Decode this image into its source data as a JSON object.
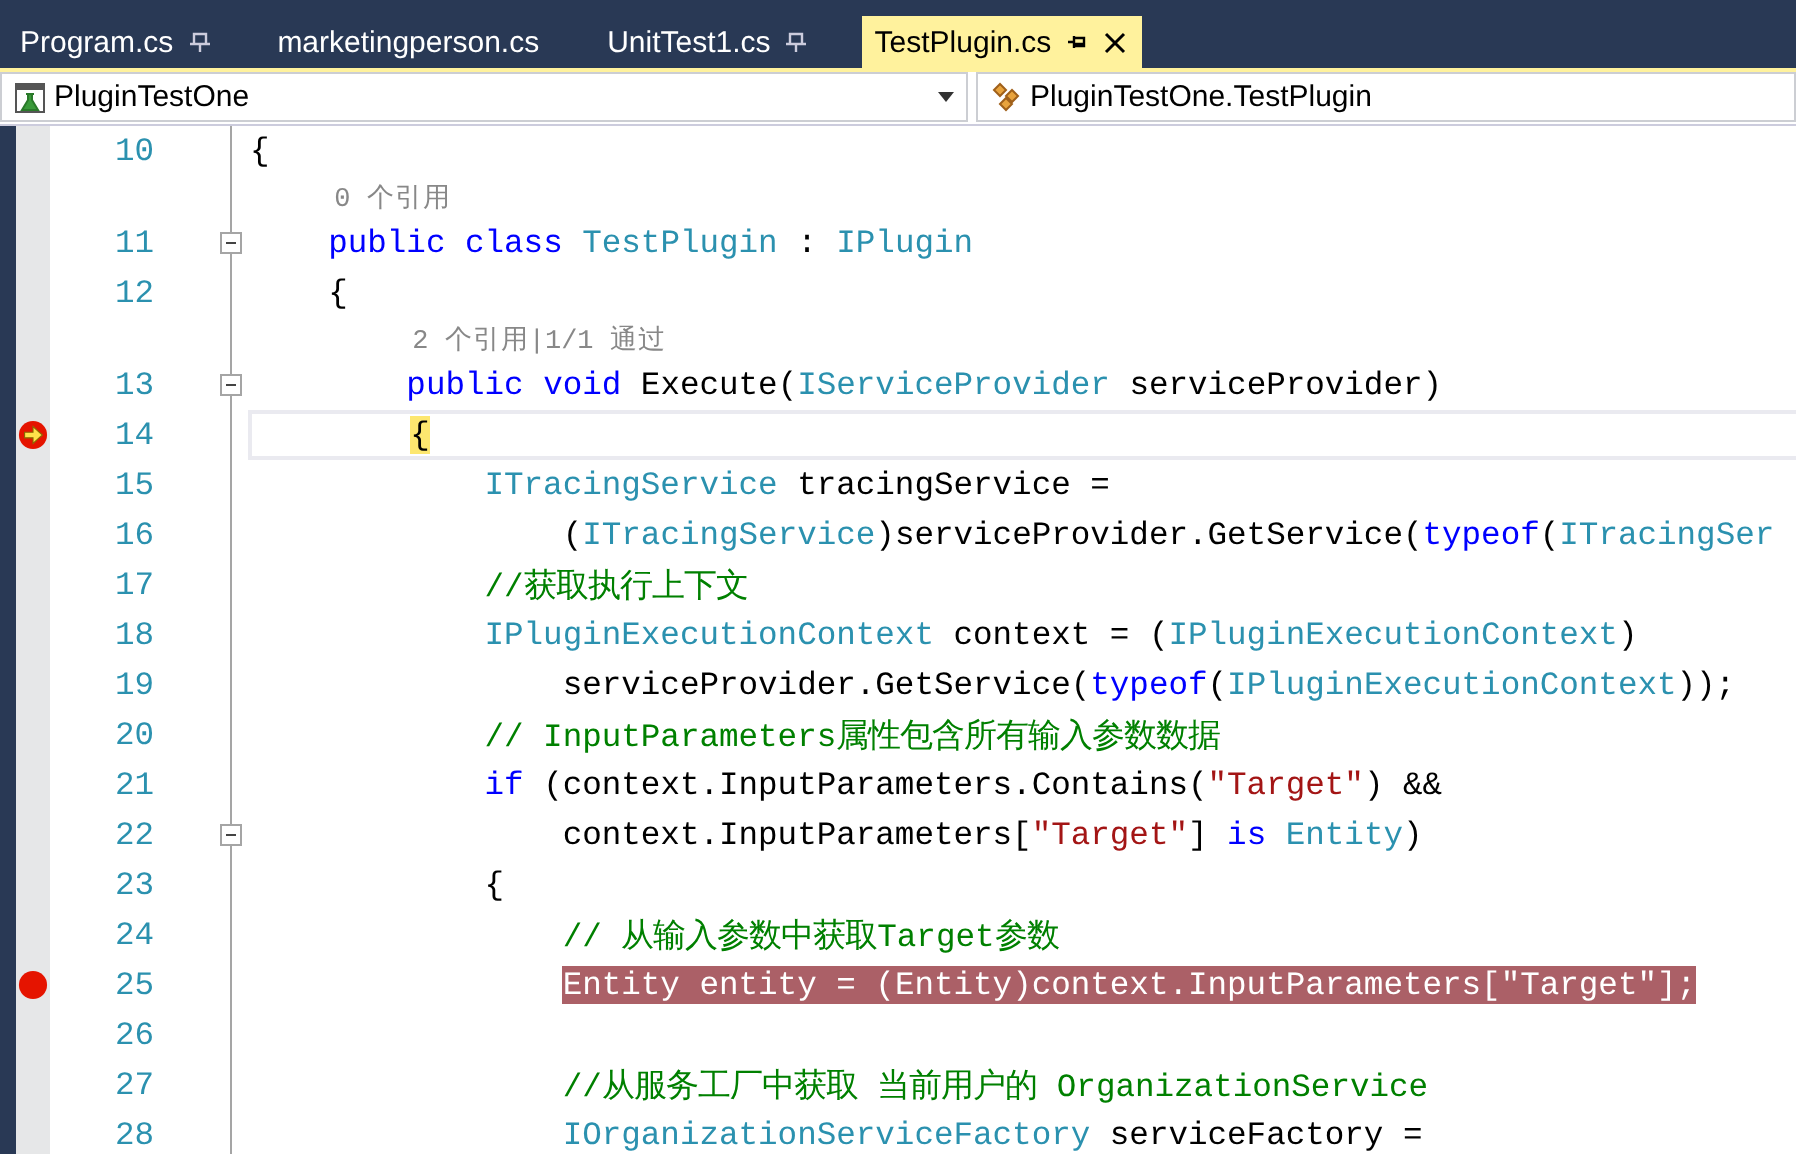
{
  "tabs": [
    {
      "label": "Program.cs",
      "selected": false,
      "pinned": true
    },
    {
      "label": "marketingperson.cs",
      "selected": false,
      "pinned": false
    },
    {
      "label": "UnitTest1.cs",
      "selected": false,
      "pinned": true
    },
    {
      "label": "TestPlugin.cs",
      "selected": true,
      "pinned": true
    }
  ],
  "navigation": {
    "project": "PluginTestOne",
    "member": "PluginTestOne.TestPlugin"
  },
  "editor": {
    "lines": [
      {
        "number": "10",
        "collapsible": false,
        "breakpoint": false,
        "current_statement": false,
        "tokens": [
          {
            "kind": "plain",
            "text": "{"
          }
        ]
      },
      {
        "number": "11",
        "hint": "0 个引用",
        "collapsible": true,
        "breakpoint": false,
        "current_statement": false,
        "tokens": [
          {
            "kind": "keyword",
            "text": "    public"
          },
          {
            "kind": "keyword",
            "text": " class"
          },
          {
            "kind": "type",
            "text": " TestPlugin"
          },
          {
            "kind": "plain",
            "text": " : "
          },
          {
            "kind": "type",
            "text": "IPlugin"
          }
        ]
      },
      {
        "number": "12",
        "collapsible": false,
        "breakpoint": false,
        "current_statement": false,
        "tokens": [
          {
            "kind": "plain",
            "text": "    {"
          }
        ]
      },
      {
        "number": "13",
        "hint": "2 个引用|1/1 通过",
        "collapsible": true,
        "breakpoint": false,
        "current_statement": false,
        "tokens": [
          {
            "kind": "keyword",
            "text": "        public"
          },
          {
            "kind": "keyword",
            "text": " void"
          },
          {
            "kind": "plain",
            "text": " Execute("
          },
          {
            "kind": "type",
            "text": "IServiceProvider"
          },
          {
            "kind": "plain",
            "text": " serviceProvider)"
          }
        ]
      },
      {
        "number": "14",
        "collapsible": false,
        "breakpoint": true,
        "current_statement": true,
        "tokens": [
          {
            "kind": "plain",
            "text": "        {"
          }
        ]
      },
      {
        "number": "15",
        "collapsible": false,
        "breakpoint": false,
        "current_statement": false,
        "tokens": [
          {
            "kind": "type",
            "text": "            ITracingService"
          },
          {
            "kind": "plain",
            "text": " tracingService ="
          }
        ]
      },
      {
        "number": "16",
        "collapsible": false,
        "breakpoint": false,
        "current_statement": false,
        "tokens": [
          {
            "kind": "plain",
            "text": "                ("
          },
          {
            "kind": "type",
            "text": "ITracingService"
          },
          {
            "kind": "plain",
            "text": ")serviceProvider.GetService("
          },
          {
            "kind": "keyword",
            "text": "typeof"
          },
          {
            "kind": "plain",
            "text": "("
          },
          {
            "kind": "type",
            "text": "ITracingSer"
          }
        ]
      },
      {
        "number": "17",
        "collapsible": false,
        "breakpoint": false,
        "current_statement": false,
        "tokens": [
          {
            "kind": "comment",
            "text": "            //获取执行上下文"
          }
        ]
      },
      {
        "number": "18",
        "collapsible": false,
        "breakpoint": false,
        "current_statement": false,
        "tokens": [
          {
            "kind": "type",
            "text": "            IPluginExecutionContext"
          },
          {
            "kind": "plain",
            "text": " context = ("
          },
          {
            "kind": "type",
            "text": "IPluginExecutionContext"
          },
          {
            "kind": "plain",
            "text": ")"
          }
        ]
      },
      {
        "number": "19",
        "collapsible": false,
        "breakpoint": false,
        "current_statement": false,
        "tokens": [
          {
            "kind": "plain",
            "text": "                serviceProvider.GetService("
          },
          {
            "kind": "keyword",
            "text": "typeof"
          },
          {
            "kind": "plain",
            "text": "("
          },
          {
            "kind": "type",
            "text": "IPluginExecutionContext"
          },
          {
            "kind": "plain",
            "text": "));"
          }
        ]
      },
      {
        "number": "20",
        "collapsible": false,
        "breakpoint": false,
        "current_statement": false,
        "tokens": [
          {
            "kind": "comment",
            "text": "            // InputParameters属性包含所有输入参数数据"
          }
        ]
      },
      {
        "number": "21",
        "collapsible": false,
        "breakpoint": false,
        "current_statement": false,
        "tokens": [
          {
            "kind": "keyword",
            "text": "            if"
          },
          {
            "kind": "plain",
            "text": " (context.InputParameters.Contains("
          },
          {
            "kind": "string",
            "text": "\"Target\""
          },
          {
            "kind": "plain",
            "text": ") &&"
          }
        ]
      },
      {
        "number": "22",
        "collapsible": true,
        "breakpoint": false,
        "current_statement": false,
        "tokens": [
          {
            "kind": "plain",
            "text": "                context.InputParameters["
          },
          {
            "kind": "string",
            "text": "\"Target\""
          },
          {
            "kind": "plain",
            "text": "] "
          },
          {
            "kind": "keyword",
            "text": "is"
          },
          {
            "kind": "type",
            "text": " Entity"
          },
          {
            "kind": "plain",
            "text": ")"
          }
        ]
      },
      {
        "number": "23",
        "collapsible": false,
        "breakpoint": false,
        "current_statement": false,
        "tokens": [
          {
            "kind": "plain",
            "text": "            {"
          }
        ]
      },
      {
        "number": "24",
        "collapsible": false,
        "breakpoint": false,
        "current_statement": false,
        "tokens": [
          {
            "kind": "comment",
            "text": "                // 从输入参数中获取Target参数"
          }
        ]
      },
      {
        "number": "25",
        "collapsible": false,
        "breakpoint": true,
        "current_statement": false,
        "tokens": [
          {
            "kind": "type",
            "text": "                Entity"
          },
          {
            "kind": "plain",
            "text": " entity = ("
          },
          {
            "kind": "type",
            "text": "Entity"
          },
          {
            "kind": "plain",
            "text": ")context.InputParameters["
          },
          {
            "kind": "string",
            "text": "\"Target\""
          },
          {
            "kind": "plain",
            "text": "];"
          }
        ]
      },
      {
        "number": "26",
        "collapsible": false,
        "breakpoint": false,
        "current_statement": false
      },
      {
        "number": "27",
        "collapsible": false,
        "breakpoint": false,
        "current_statement": false,
        "tokens": [
          {
            "kind": "comment",
            "text": "                //从服务工厂中获取 当前用户的 OrganizationService"
          }
        ]
      },
      {
        "number": "28",
        "collapsible": false,
        "breakpoint": false,
        "current_statement": false,
        "tokens": [
          {
            "kind": "type",
            "text": "                IOrganizationServiceFactory"
          },
          {
            "kind": "plain",
            "text": " serviceFactory ="
          }
        ]
      }
    ]
  }
}
